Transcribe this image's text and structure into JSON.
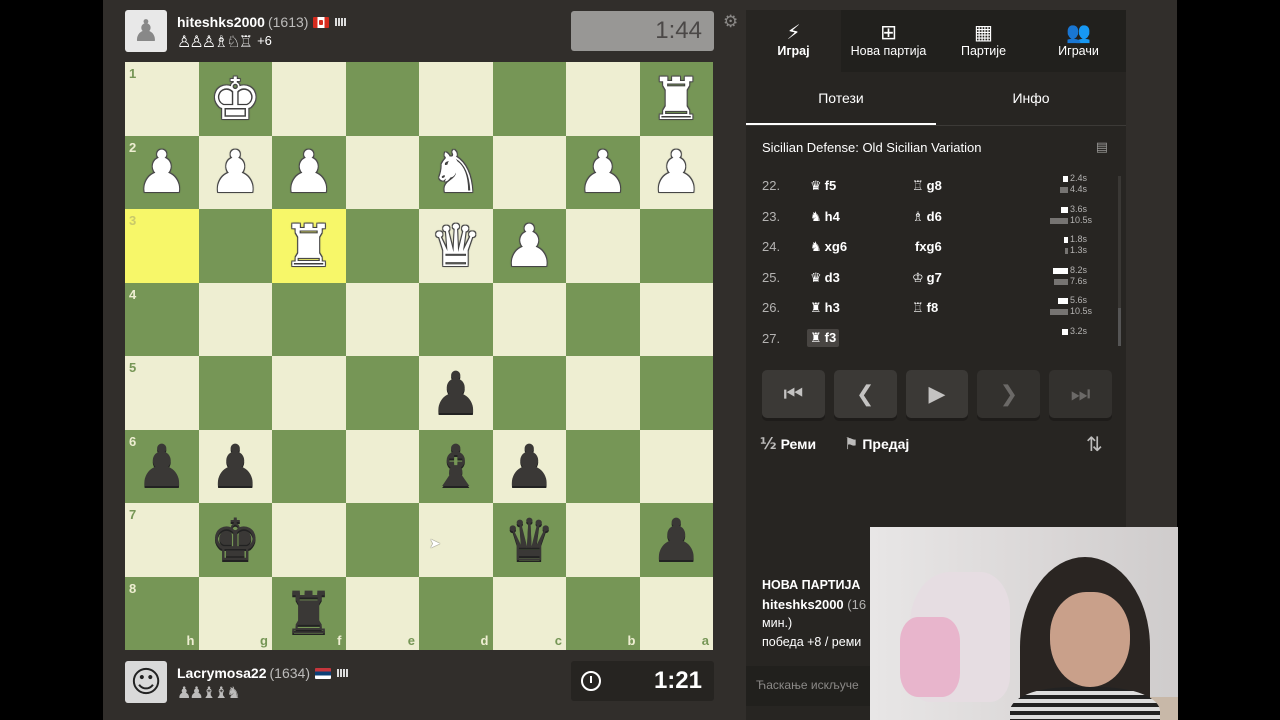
{
  "top_player": {
    "name": "hiteshks2000",
    "rating": "(1613)",
    "captured": "♙♙♙♗♘♖",
    "advantage": "+6",
    "clock": "1:44"
  },
  "bottom_player": {
    "name": "Lacrymosa22",
    "rating": "(1634)",
    "captured": "♟♟♝♝♞",
    "clock": "1:21"
  },
  "board": {
    "rank_labels": [
      "1",
      "2",
      "3",
      "4",
      "5",
      "6",
      "7",
      "8"
    ],
    "file_labels": [
      "h",
      "g",
      "f",
      "e",
      "d",
      "c",
      "b",
      "a"
    ],
    "rows": [
      [
        "",
        "wK",
        "",
        "",
        "",
        "",
        "",
        "wR"
      ],
      [
        "wP",
        "wP",
        "wP",
        "",
        "wN",
        "",
        "wP",
        "wP"
      ],
      [
        "",
        "",
        "wR",
        "",
        "wQ",
        "wP",
        "",
        ""
      ],
      [
        "",
        "",
        "",
        "",
        "",
        "",
        "",
        ""
      ],
      [
        "",
        "",
        "",
        "",
        "bP",
        "",
        "",
        ""
      ],
      [
        "bP",
        "bP",
        "",
        "",
        "bB",
        "bP",
        "",
        ""
      ],
      [
        "",
        "bK",
        "",
        "",
        "",
        "bQ",
        "",
        "bP"
      ],
      [
        "",
        "",
        "bR",
        "",
        "",
        "",
        "",
        ""
      ]
    ],
    "highlighted": [
      [
        2,
        0
      ],
      [
        2,
        2
      ]
    ]
  },
  "nav": [
    {
      "label": "Играј",
      "icon": "lightning-icon"
    },
    {
      "label": "Нова партија",
      "icon": "plus-icon"
    },
    {
      "label": "Партије",
      "icon": "board-icon"
    },
    {
      "label": "Играчи",
      "icon": "players-icon"
    }
  ],
  "subtabs": [
    "Потези",
    "Инфо"
  ],
  "opening": "Sicilian Defense: Old Sicilian Variation",
  "moves": [
    {
      "num": "22.",
      "w_piece": "♛",
      "w": "f5",
      "b_piece": "♖",
      "b": "g8",
      "wt": "2.4s",
      "bt": "4.4s",
      "wbar": 5,
      "bbar": 8
    },
    {
      "num": "23.",
      "w_piece": "♞",
      "w": "h4",
      "b_piece": "♗",
      "b": "d6",
      "wt": "3.6s",
      "bt": "10.5s",
      "wbar": 7,
      "bbar": 18
    },
    {
      "num": "24.",
      "w_piece": "♞",
      "w": "xg6",
      "b_piece": "",
      "b": "fxg6",
      "wt": "1.8s",
      "bt": "1.3s",
      "wbar": 4,
      "bbar": 3
    },
    {
      "num": "25.",
      "w_piece": "♛",
      "w": "d3",
      "b_piece": "♔",
      "b": "g7",
      "wt": "8.2s",
      "bt": "7.6s",
      "wbar": 15,
      "bbar": 14
    },
    {
      "num": "26.",
      "w_piece": "♜",
      "w": "h3",
      "b_piece": "♖",
      "b": "f8",
      "wt": "5.6s",
      "bt": "10.5s",
      "wbar": 10,
      "bbar": 18
    },
    {
      "num": "27.",
      "w_piece": "♜",
      "w": "f3",
      "b_piece": "",
      "b": "",
      "wt": "3.2s",
      "bt": "",
      "wbar": 6,
      "bbar": 0
    }
  ],
  "controls": [
    "first-move",
    "previous-move",
    "play",
    "next-move",
    "last-move"
  ],
  "actions": {
    "draw": "Реми",
    "draw_icon": "½",
    "resign": "Предај"
  },
  "new_game": {
    "heading": "НОВА ПАРТИЈА",
    "player": "hiteshks2000",
    "rating": "(16",
    "line2": "мин.)",
    "line3": "победа +8 / реми"
  },
  "chat_placeholder": "Ћаскање искључе"
}
